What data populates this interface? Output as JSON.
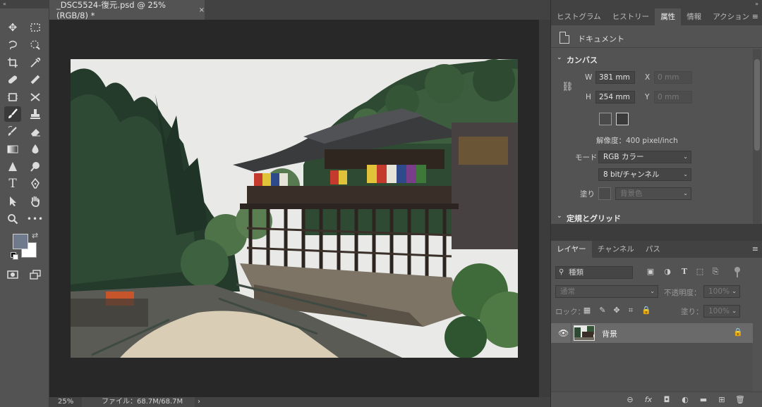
{
  "toolbar": {
    "collapse": "«",
    "tools": [
      {
        "name": "move-tool-icon",
        "glyph": "✥"
      },
      {
        "name": "marquee-tool-icon",
        "glyph": "⬚"
      },
      {
        "name": "lasso-tool-icon",
        "glyph": "➰"
      },
      {
        "name": "quick-select-tool-icon",
        "glyph": "✎"
      },
      {
        "name": "crop-tool-icon",
        "glyph": "⌗"
      },
      {
        "name": "eyedropper-tool-icon",
        "glyph": "✑"
      },
      {
        "name": "spot-healing-tool-icon",
        "glyph": "✚"
      },
      {
        "name": "brush-tool-icon",
        "glyph": "✎"
      },
      {
        "name": "stamp-tool-icon",
        "glyph": "♜"
      },
      {
        "name": "history-brush-tool-icon",
        "glyph": "✐"
      },
      {
        "name": "eraser-tool-icon",
        "glyph": "⌫"
      },
      {
        "name": "gradient-tool-icon",
        "glyph": "▦"
      },
      {
        "name": "blur-tool-icon",
        "glyph": "●"
      },
      {
        "name": "dodge-tool-icon",
        "glyph": "⚲"
      },
      {
        "name": "pen-tool-icon",
        "glyph": "✒"
      },
      {
        "name": "type-tool-icon",
        "glyph": "T"
      },
      {
        "name": "path-select-tool-icon",
        "glyph": "➤"
      },
      {
        "name": "shape-tool-icon",
        "glyph": "▭"
      },
      {
        "name": "hand-tool-icon",
        "glyph": "✋"
      },
      {
        "name": "zoom-tool-icon",
        "glyph": "⚲"
      },
      {
        "name": "more-tools-icon",
        "glyph": "•••"
      },
      {
        "name": "quick-mask-icon",
        "glyph": "◙"
      },
      {
        "name": "screen-mode-icon",
        "glyph": "⧉"
      }
    ],
    "swap_glyph": "⇄"
  },
  "document": {
    "tab_title": "_DSC5524-復元.psd @ 25% (RGB/8) *",
    "tab_close": "×"
  },
  "status": {
    "zoom": "25%",
    "file_info": "ファイル：68.7M/68.7M",
    "arrow": "›"
  },
  "top_tabs": [
    "ヒストグラム",
    "ヒストリー",
    "属性",
    "情報",
    "アクション"
  ],
  "top_tabs_active": 2,
  "panel_menu": "≡",
  "properties": {
    "doc_label": "ドキュメント",
    "canvas_section": "カンバス",
    "w_label": "W",
    "w_value": "381 mm",
    "h_label": "H",
    "h_value": "254 mm",
    "x_label": "X",
    "x_value": "0 mm",
    "y_label": "Y",
    "y_value": "0 mm",
    "resolution": "解像度：400 pixel/inch",
    "mode_label": "モード",
    "mode_value": "RGB カラー",
    "bitdepth_value": "8 bit/チャンネル",
    "fill_label": "塗り",
    "fill_value": "背景色",
    "guides_section": "定規とグリッド",
    "chev_open": "⌄",
    "select_arrow": "⌄"
  },
  "layers_tabs": [
    "レイヤー",
    "チャンネル",
    "パス"
  ],
  "layers_tabs_active": 0,
  "layers": {
    "filter_placeholder": "種類",
    "blend_mode": "通常",
    "opacity_label": "不透明度：",
    "opacity_value": "100%",
    "lock_label": "ロック：",
    "fill_label": "塗り：",
    "fill_value": "100%",
    "layer_name": "背景",
    "bottom_icons": [
      "link-layers-icon",
      "fx-icon",
      "add-mask-icon",
      "adjustment-layer-icon",
      "new-group-icon",
      "new-layer-icon",
      "delete-layer-icon"
    ],
    "bottom_glyphs": [
      "⊖",
      "fx",
      "◘",
      "◐",
      "▬",
      "⊞",
      "🗑"
    ]
  },
  "colors": {
    "foreground": "#6f7a8c",
    "background": "#ffffff",
    "panel": "#535353",
    "canvas_bg": "#282828"
  }
}
